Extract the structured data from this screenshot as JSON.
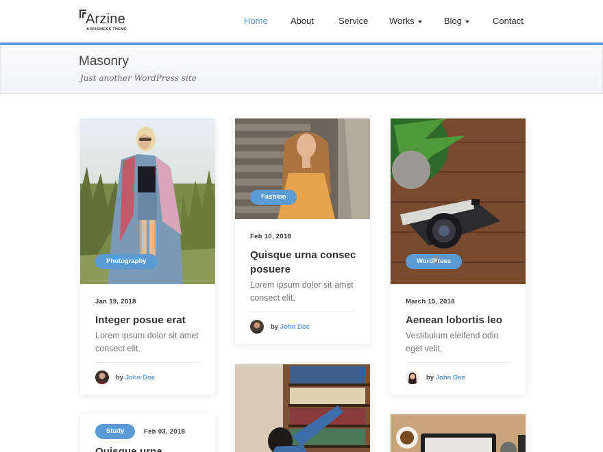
{
  "brand": {
    "name": "Arzine",
    "tagline": "A BUSINESS THEME"
  },
  "nav": {
    "items": [
      {
        "label": "Home",
        "active": true,
        "dropdown": false
      },
      {
        "label": "About",
        "active": false,
        "dropdown": false
      },
      {
        "label": "Service",
        "active": false,
        "dropdown": false
      },
      {
        "label": "Works",
        "active": false,
        "dropdown": true
      },
      {
        "label": "Blog",
        "active": false,
        "dropdown": true
      },
      {
        "label": "Contact",
        "active": false,
        "dropdown": false
      }
    ]
  },
  "page": {
    "title": "Masonry",
    "subtitle": "Just another WordPress site"
  },
  "posts": [
    {
      "category": "Photography",
      "date": "Jan 19, 2018",
      "title": "Integer posue erat",
      "excerpt": "Lorem ipsum dolor sit amet consect elit.",
      "by": "by",
      "author": "John Doe"
    },
    {
      "category": "Fashion",
      "date": "Feb 10, 2018",
      "title": "Quisque urna consec posuere",
      "excerpt": "Lorem ipsum dolor sit amet consect elit.",
      "by": "by",
      "author": "John Doe"
    },
    {
      "category": "WordPress",
      "date": "March 15, 2018",
      "title": "Aenean lobortis leo",
      "excerpt": "Vestibulum eleifend odio eget velit.",
      "by": "by",
      "author": "John Doe"
    },
    {
      "category": "Study",
      "date": "Feb 03, 2018",
      "title": "Quisque urna"
    }
  ],
  "colors": {
    "accent": "#5b9bd5",
    "text": "#333333",
    "muted": "#777777"
  }
}
